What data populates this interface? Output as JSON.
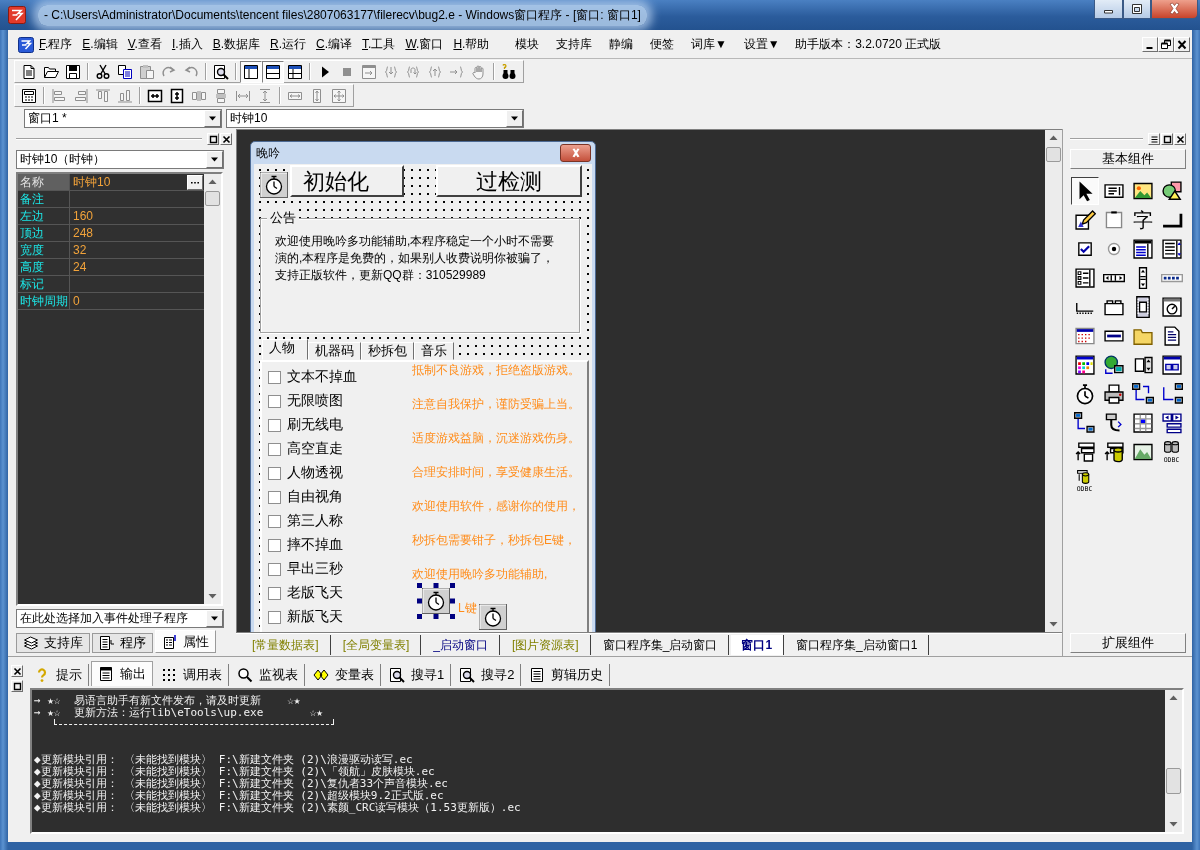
{
  "window": {
    "title": "- C:\\Users\\Administrator\\Documents\\tencent files\\2807063177\\filerecv\\bug2.e - Windows窗口程序 - [窗口: 窗口1]"
  },
  "menu": [
    {
      "key": "F",
      "label": ".程序"
    },
    {
      "key": "E",
      "label": ".编辑"
    },
    {
      "key": "V",
      "label": ".查看"
    },
    {
      "key": "I",
      "label": ".插入"
    },
    {
      "key": "B",
      "label": ".数据库"
    },
    {
      "key": "R",
      "label": ".运行"
    },
    {
      "key": "C",
      "label": ".编译"
    },
    {
      "key": "T",
      "label": ".工具"
    },
    {
      "key": "W",
      "label": ".窗口"
    },
    {
      "key": "H",
      "label": ".帮助"
    },
    {
      "label": "模块"
    },
    {
      "label": "支持库"
    },
    {
      "label": "静编"
    },
    {
      "label": "便签"
    },
    {
      "label": "词库▼"
    },
    {
      "label": "设置▼"
    }
  ],
  "version": "助手版本：3.2.0720 正式版",
  "toolbars": [
    {
      "groups": [
        [
          {
            "kind": "new",
            "disabled": false
          },
          {
            "kind": "open",
            "disabled": false
          },
          {
            "kind": "save",
            "disabled": false
          }
        ],
        [
          {
            "kind": "cut",
            "disabled": false
          },
          {
            "kind": "copy",
            "disabled": false
          },
          {
            "kind": "paste",
            "disabled": true
          },
          {
            "kind": "redo",
            "disabled": true
          },
          {
            "kind": "undo",
            "disabled": true
          }
        ],
        [
          {
            "kind": "find",
            "disabled": false
          }
        ],
        [
          {
            "kind": "layout-a",
            "disabled": false,
            "pressed": true
          },
          {
            "kind": "layout-b",
            "disabled": false,
            "pressed": true
          },
          {
            "kind": "layout-c",
            "disabled": false,
            "pressed": false
          }
        ],
        [
          {
            "kind": "run",
            "disabled": false
          },
          {
            "kind": "stop",
            "disabled": true
          },
          {
            "kind": "step",
            "disabled": true
          },
          {
            "kind": "step-in",
            "disabled": true
          },
          {
            "kind": "step-over",
            "disabled": true
          },
          {
            "kind": "step-out",
            "disabled": true
          },
          {
            "kind": "run-to",
            "disabled": true
          },
          {
            "kind": "hand",
            "disabled": true
          }
        ],
        [
          {
            "kind": "binoculars",
            "disabled": false
          }
        ]
      ]
    },
    {
      "groups": [
        [
          {
            "kind": "form",
            "disabled": false
          }
        ],
        [
          {
            "kind": "align-l",
            "disabled": true
          },
          {
            "kind": "align-r",
            "disabled": true
          },
          {
            "kind": "align-t",
            "disabled": true
          },
          {
            "kind": "align-b",
            "disabled": true
          }
        ],
        [
          {
            "kind": "center-h",
            "disabled": false
          },
          {
            "kind": "center-v",
            "disabled": false
          },
          {
            "kind": "space-h",
            "disabled": true
          },
          {
            "kind": "space-v",
            "disabled": true
          },
          {
            "kind": "size-h",
            "disabled": true
          },
          {
            "kind": "size-v",
            "disabled": true
          }
        ],
        [
          {
            "kind": "same-w",
            "disabled": true
          },
          {
            "kind": "same-h",
            "disabled": true
          },
          {
            "kind": "same-size",
            "disabled": true
          }
        ]
      ]
    }
  ],
  "selectors": [
    "窗口1 *",
    "时钟10"
  ],
  "properties_panel": {
    "object": "时钟10（时钟）",
    "rows": [
      {
        "name": "名称",
        "value": "时钟10",
        "selected": true
      },
      {
        "name": "备注",
        "selected": false
      },
      {
        "name": "左边",
        "value": "160",
        "selected": false
      },
      {
        "name": "顶边",
        "value": "248",
        "selected": false
      },
      {
        "name": "宽度",
        "value": "32",
        "selected": false
      },
      {
        "name": "高度",
        "value": "24",
        "selected": false
      },
      {
        "name": "标记",
        "selected": false
      },
      {
        "name": "时钟周期",
        "value": "0",
        "selected": false
      }
    ],
    "event_selector": "在此处选择加入事件处理子程序",
    "tabs": [
      {
        "label": "支持库",
        "kind": "library",
        "selected": false
      },
      {
        "label": "程序",
        "kind": "program",
        "selected": false
      },
      {
        "label": "属性",
        "kind": "properties",
        "selected": true
      }
    ]
  },
  "form": {
    "title": "晚吟",
    "buttons": [
      "初始化",
      "过检测"
    ],
    "notice": {
      "title": "公告",
      "lines": [
        "欢迎使用晚吟多功能辅助,本程序稳定一个小时不需要",
        "演的,本程序是免费的，如果别人收费说明你被骗了，",
        "支持正版软件，更新QQ群：310529989"
      ]
    },
    "tabs": [
      {
        "label": "人物",
        "selected": true
      },
      {
        "label": "机器码",
        "selected": false
      },
      {
        "label": "秒拆包",
        "selected": false
      },
      {
        "label": "音乐",
        "selected": false
      }
    ],
    "checkboxes": [
      {
        "label": "文本不掉血",
        "checked": false
      },
      {
        "label": "无限喷图",
        "checked": false
      },
      {
        "label": "刷无线电",
        "checked": false
      },
      {
        "label": "高空直走",
        "checked": false
      },
      {
        "label": "人物透视",
        "checked": false
      },
      {
        "label": "自由视角",
        "checked": false
      },
      {
        "label": "第三人称",
        "checked": false
      },
      {
        "label": "摔不掉血",
        "checked": false
      },
      {
        "label": "早出三秒",
        "checked": false
      },
      {
        "label": "老版飞天",
        "checked": false
      },
      {
        "label": "新版飞天",
        "checked": false
      }
    ],
    "tips": [
      "抵制不良游戏，拒绝盗版游戏。",
      "注意自我保护，谨防受骗上当。",
      "适度游戏益脑，沉迷游戏伤身。",
      "合理安排时间，享受健康生活。",
      "欢迎使用软件，感谢你的使用，",
      "秒拆包需要钳子，秒拆包E键，",
      "欢迎使用晚吟多功能辅助,",
      "L键"
    ],
    "timers": [
      {
        "selected": false
      },
      {
        "selected": true
      },
      {
        "selected": false
      }
    ]
  },
  "document_tabs": [
    {
      "label": "[常量数据表]",
      "kind": "table",
      "selected": false
    },
    {
      "label": "[全局变量表]",
      "kind": "table",
      "selected": false
    },
    {
      "label": "_启动窗口",
      "kind": "window",
      "selected": false
    },
    {
      "label": "[图片资源表]",
      "kind": "table",
      "selected": false
    },
    {
      "label": "窗口程序集_启动窗口",
      "kind": "code",
      "selected": false
    },
    {
      "label": "窗口1",
      "kind": "window",
      "selected": true
    },
    {
      "label": "窗口程序集_启动窗口1",
      "kind": "code",
      "selected": false
    }
  ],
  "toolbox": {
    "header": "基本组件",
    "tools": [
      {
        "kind": "pointer",
        "selected": true
      },
      {
        "kind": "label",
        "selected": false
      },
      {
        "kind": "picture",
        "selected": false
      },
      {
        "kind": "shapes",
        "selected": false
      },
      {
        "kind": "edit",
        "selected": false
      },
      {
        "kind": "frame",
        "selected": false
      },
      {
        "kind": "character",
        "label": "字",
        "selected": false
      },
      {
        "kind": "corner",
        "selected": false
      },
      {
        "kind": "checkbox",
        "selected": false
      },
      {
        "kind": "radio",
        "selected": false
      },
      {
        "kind": "combo",
        "selected": false
      },
      {
        "kind": "listbox",
        "selected": false
      },
      {
        "kind": "checklist",
        "selected": false
      },
      {
        "kind": "hscroll",
        "selected": false
      },
      {
        "kind": "vscroll",
        "selected": false
      },
      {
        "kind": "progress",
        "selected": false
      },
      {
        "kind": "slider",
        "selected": false
      },
      {
        "kind": "tabframe",
        "selected": false
      },
      {
        "kind": "film",
        "selected": false
      },
      {
        "kind": "clockwin",
        "selected": false
      },
      {
        "kind": "calendar",
        "selected": false
      },
      {
        "kind": "textfield",
        "selected": false
      },
      {
        "kind": "dirfolder",
        "selected": false
      },
      {
        "kind": "page",
        "selected": false
      },
      {
        "kind": "palette",
        "selected": false
      },
      {
        "kind": "globepc",
        "selected": false
      },
      {
        "kind": "spinbox",
        "selected": false
      },
      {
        "kind": "winbtns",
        "selected": false
      },
      {
        "kind": "stopwatch",
        "selected": false
      },
      {
        "kind": "printer",
        "selected": false
      },
      {
        "kind": "link-up",
        "selected": false
      },
      {
        "kind": "link-down",
        "selected": false
      },
      {
        "kind": "link",
        "selected": false
      },
      {
        "kind": "cable",
        "selected": false
      },
      {
        "kind": "grid",
        "selected": false
      },
      {
        "kind": "navbar",
        "selected": false
      },
      {
        "kind": "reclist",
        "selected": false
      },
      {
        "kind": "dbfile",
        "selected": false
      },
      {
        "kind": "landscape",
        "selected": false
      },
      {
        "kind": "odbc-pair",
        "label": "ODBC",
        "selected": false
      },
      {
        "kind": "odbc",
        "label": "ODBC",
        "selected": false
      }
    ],
    "footer": "扩展组件"
  },
  "bottom_tabs": [
    {
      "label": "提示",
      "kind": "hint",
      "selected": false
    },
    {
      "label": "输出",
      "kind": "output",
      "selected": true
    },
    {
      "label": "调用表",
      "kind": "calls",
      "selected": false
    },
    {
      "label": "监视表",
      "kind": "watch",
      "selected": false
    },
    {
      "label": "变量表",
      "kind": "variables",
      "selected": false
    },
    {
      "label": "搜寻1",
      "kind": "search",
      "selected": false
    },
    {
      "label": "搜寻2",
      "kind": "search",
      "selected": false
    },
    {
      "label": "剪辑历史",
      "kind": "history",
      "selected": false
    }
  ],
  "output": {
    "notice_lines": [
      "→ ★☆  易语言助手有新文件发布，请及时更新    ☆★",
      "→ ★☆  更新方法：运行lib\\eTools\\up.exe       ☆★"
    ],
    "log_lines": [
      "◆更新模块引用： 〈未能找到模块〉 F:\\新建文件夹 (2)\\浪漫驱动读写.ec",
      "◆更新模块引用： 〈未能找到模块〉 F:\\新建文件夹 (2)\\「领航」皮肤模块.ec",
      "◆更新模块引用： 〈未能找到模块〉 F:\\新建文件夹 (2)\\复仇者33个声音模块.ec",
      "◆更新模块引用： 〈未能找到模块〉 F:\\新建文件夹 (2)\\超级模块9.2正式版.ec",
      "◆更新模块引用： 〈未能找到模块〉 F:\\新建文件夹 (2)\\素颜_CRC读写模块（1.53更新版）.ec"
    ]
  }
}
